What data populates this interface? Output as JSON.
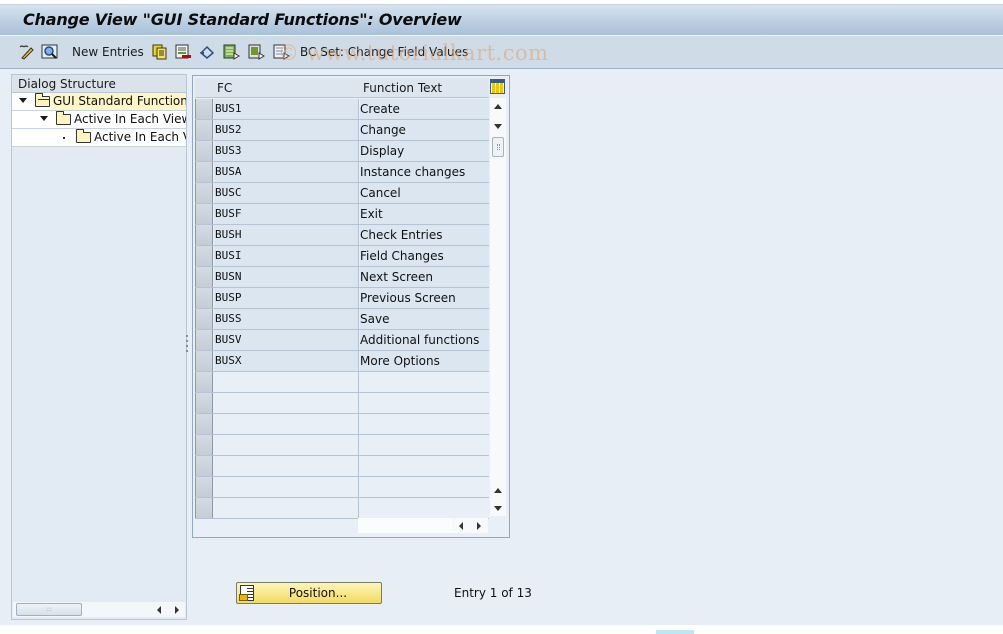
{
  "window": {
    "title": "Change View \"GUI Standard Functions\": Overview"
  },
  "toolbar": {
    "items": [
      {
        "icon": "display-change-icon",
        "tooltip": "Display -> Change"
      },
      {
        "icon": "find-icon",
        "tooltip": "Find"
      },
      {
        "label": "New Entries"
      },
      {
        "icon": "copy-as-icon"
      },
      {
        "icon": "delete-icon"
      },
      {
        "icon": "undo-change-icon"
      },
      {
        "icon": "select-all-icon"
      },
      {
        "icon": "select-block-icon"
      },
      {
        "icon": "deselect-all-icon"
      },
      {
        "label": "BC Set: Change Field Values"
      }
    ],
    "new_entries_label": "New Entries",
    "bcset_label": "BC Set: Change Field Values",
    "watermark": "© www.tutorialkart.com"
  },
  "dialog_structure": {
    "header": "Dialog Structure",
    "nodes": [
      {
        "label": "GUI Standard Functions",
        "level": 0,
        "expanded": true,
        "selected": true,
        "folder": "open"
      },
      {
        "label": "Active In Each View",
        "level": 1,
        "expanded": true,
        "selected": false,
        "folder": "closed"
      },
      {
        "label": "Active In Each Vi",
        "level": 2,
        "expanded": false,
        "selected": false,
        "folder": "closed"
      }
    ]
  },
  "table": {
    "columns": [
      "FC",
      "Function Text"
    ],
    "rows": [
      {
        "fc": "BUS1",
        "text": "Create"
      },
      {
        "fc": "BUS2",
        "text": "Change"
      },
      {
        "fc": "BUS3",
        "text": "Display"
      },
      {
        "fc": "BUSA",
        "text": "Instance changes"
      },
      {
        "fc": "BUSC",
        "text": "Cancel"
      },
      {
        "fc": "BUSF",
        "text": "Exit"
      },
      {
        "fc": "BUSH",
        "text": "Check Entries"
      },
      {
        "fc": "BUSI",
        "text": "Field Changes"
      },
      {
        "fc": "BUSN",
        "text": "Next Screen"
      },
      {
        "fc": "BUSP",
        "text": "Previous Screen"
      },
      {
        "fc": "BUSS",
        "text": "Save"
      },
      {
        "fc": "BUSV",
        "text": "Additional functions"
      },
      {
        "fc": "BUSX",
        "text": "More Options"
      },
      {
        "fc": "",
        "text": ""
      },
      {
        "fc": "",
        "text": ""
      },
      {
        "fc": "",
        "text": ""
      },
      {
        "fc": "",
        "text": ""
      },
      {
        "fc": "",
        "text": ""
      },
      {
        "fc": "",
        "text": ""
      },
      {
        "fc": "",
        "text": ""
      }
    ]
  },
  "footer": {
    "position_button": "Position...",
    "entry_text": "Entry 1 of 13"
  }
}
